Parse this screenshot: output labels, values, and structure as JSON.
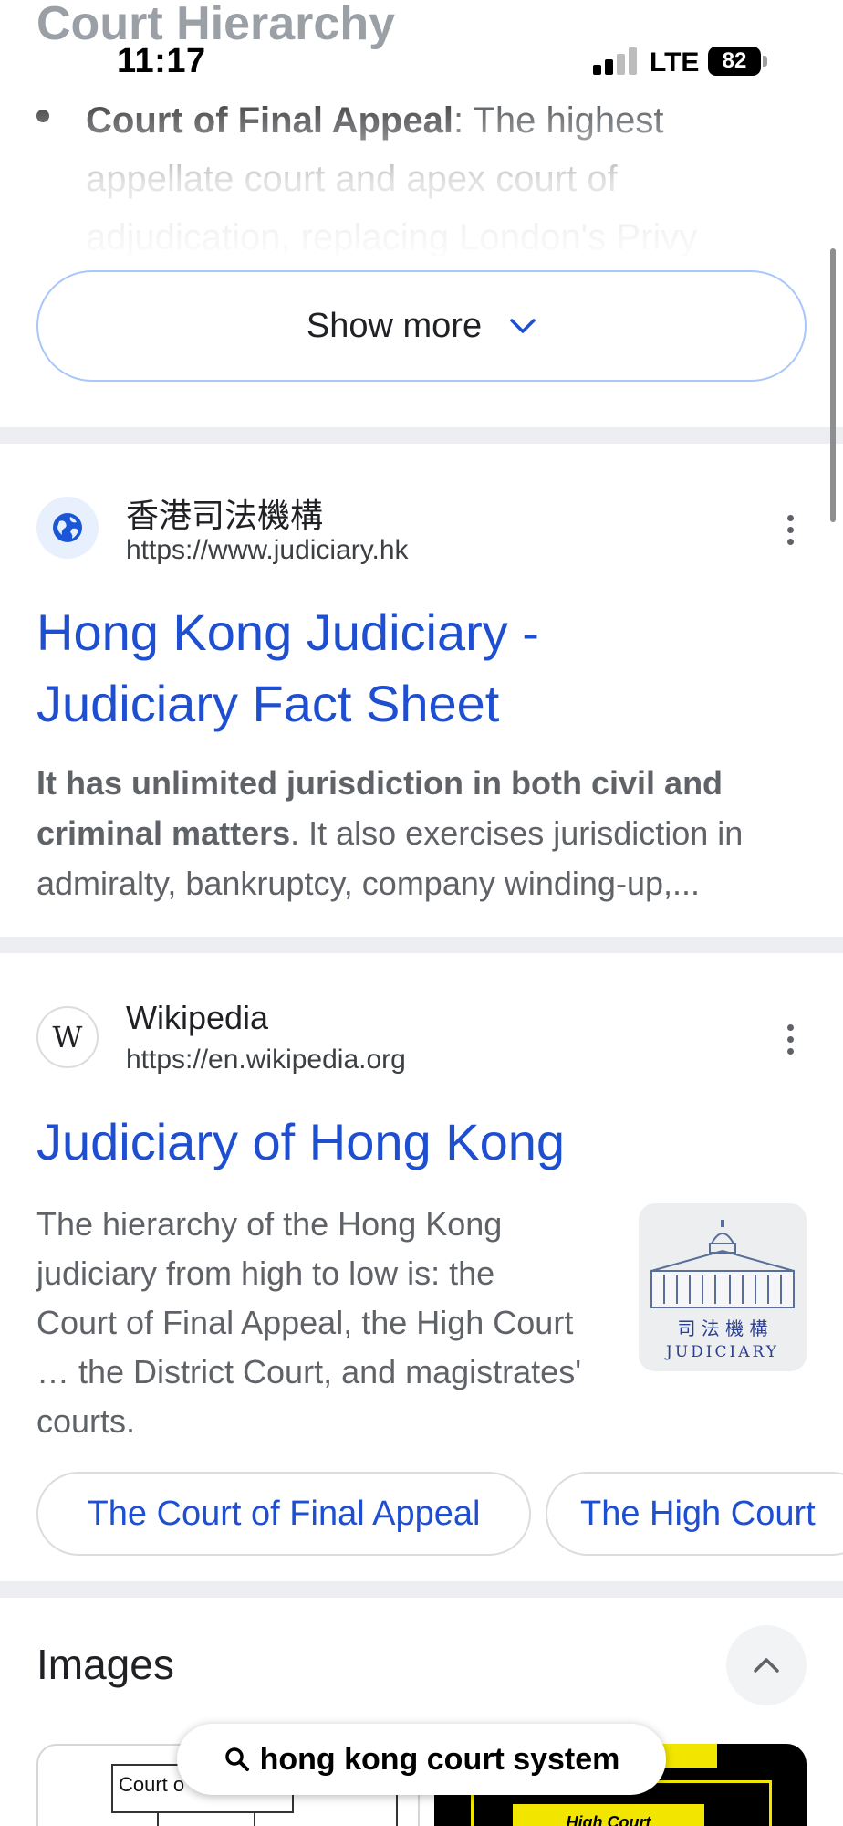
{
  "status_bar": {
    "time": "11:17",
    "network": "LTE",
    "battery": "82"
  },
  "overview": {
    "heading": "Court Hierarchy",
    "bullet_bold": "Court of Final Appeal",
    "bullet_text": ": The highest appellate court and apex court of adjudication, replacing London's Privy",
    "show_more_label": "Show more"
  },
  "results": [
    {
      "site_name": "香港司法機構",
      "url": "https://www.judiciary.hk",
      "title_line1": "Hong Kong Judiciary -",
      "title_line2": "Judiciary Fact Sheet",
      "snippet_bold": "It has unlimited jurisdiction in both civil and criminal matters",
      "snippet_rest": ". It also exercises jurisdiction in admiralty, bankruptcy, company winding-up,..."
    },
    {
      "site_name": "Wikipedia",
      "url": "https://en.wikipedia.org",
      "favicon_letter": "W",
      "title": "Judiciary of Hong Kong",
      "snippet": "The hierarchy of the Hong Kong judiciary from high to low is: the Court of Final Appeal, the High Court … the District Court, and magistrates' courts.",
      "thumb_chinese": "司 法 機 構",
      "thumb_english": "JUDICIARY",
      "chips": [
        "The Court of Final Appeal",
        "The High Court"
      ]
    }
  ],
  "images": {
    "heading": "Images",
    "left_image_label": "Court o",
    "right_image_label": "High Court"
  },
  "search_pill": {
    "query": "hong kong court system"
  },
  "colors": {
    "link": "#1f4fd1",
    "chip_border": "#dadce0",
    "show_more_border": "#a8c7fa",
    "divider": "#eceef1"
  }
}
